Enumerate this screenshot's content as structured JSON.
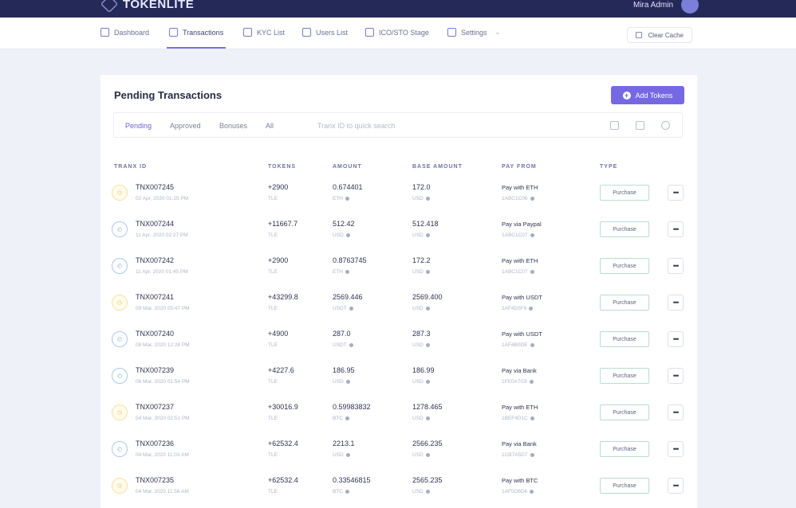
{
  "brand": {
    "name": "TOKENLITE"
  },
  "user": {
    "name": "Mira Admin"
  },
  "nav": {
    "items": [
      {
        "label": "Dashboard"
      },
      {
        "label": "Transactions"
      },
      {
        "label": "KYC List"
      },
      {
        "label": "Users List"
      },
      {
        "label": "ICO/STO Stage"
      },
      {
        "label": "Settings"
      }
    ],
    "clear_cache": "Clear Cache"
  },
  "page": {
    "title": "Pending Transactions",
    "add_button": "Add Tokens"
  },
  "filters": {
    "tabs": [
      "Pending",
      "Approved",
      "Bonuses",
      "All"
    ],
    "search_placeholder": "Tranx ID to quick search"
  },
  "table": {
    "headers": [
      "TRANX ID",
      "TOKENS",
      "AMOUNT",
      "BASE AMOUNT",
      "PAY FROM",
      "TYPE"
    ],
    "rows": [
      {
        "status": "warn",
        "id": "TNX007245",
        "date": "02 Apr, 2020 01:25 PM",
        "tokens": "+2900",
        "token_sym": "TLE",
        "amount": "0.674401",
        "amount_cur": "ETH",
        "base": "172.0",
        "base_cur": "USD",
        "pay": "Pay with ETH",
        "pay_sub": "1ABC1C06",
        "type": "Purchase"
      },
      {
        "status": "info",
        "id": "TNX007244",
        "date": "11 Apr, 2020 02:27 PM",
        "tokens": "+11667.7",
        "token_sym": "TLE",
        "amount": "512.42",
        "amount_cur": "USD",
        "base": "512.418",
        "base_cur": "USD",
        "pay": "Pay via Paypal",
        "pay_sub": "1ABC1C07",
        "type": "Purchase"
      },
      {
        "status": "info",
        "id": "TNX007242",
        "date": "11 Apr, 2020 01:45 PM",
        "tokens": "+2900",
        "token_sym": "TLE",
        "amount": "0.8763745",
        "amount_cur": "ETH",
        "base": "172.2",
        "base_cur": "USD",
        "pay": "Pay with ETH",
        "pay_sub": "1ABC1C07",
        "type": "Purchase"
      },
      {
        "status": "warn",
        "id": "TNX007241",
        "date": "09 Mar, 2020 05:47 PM",
        "tokens": "+43299.8",
        "token_sym": "TLE",
        "amount": "2569.446",
        "amount_cur": "USDT",
        "base": "2569.400",
        "base_cur": "USD",
        "pay": "Pay with USDT",
        "pay_sub": "1AF4D5F6",
        "type": "Purchase"
      },
      {
        "status": "info",
        "id": "TNX007240",
        "date": "08 Mar, 2020 12:28 PM",
        "tokens": "+4900",
        "token_sym": "TLE",
        "amount": "287.0",
        "amount_cur": "USDT",
        "base": "287.3",
        "base_cur": "USD",
        "pay": "Pay with USDT",
        "pay_sub": "1AF4B0DE",
        "type": "Purchase"
      },
      {
        "status": "info",
        "id": "TNX007239",
        "date": "06 Mar, 2020 01:54 PM",
        "tokens": "+4227.6",
        "token_sym": "TLE",
        "amount": "186.95",
        "amount_cur": "USD",
        "base": "186.99",
        "base_cur": "USD",
        "pay": "Pay via Bank",
        "pay_sub": "1FE0A7C8",
        "type": "Purchase"
      },
      {
        "status": "warn",
        "id": "TNX007237",
        "date": "04 Mar, 2020 02:51 PM",
        "tokens": "+30016.9",
        "token_sym": "TLE",
        "amount": "0.59983832",
        "amount_cur": "BTC",
        "base": "1278.465",
        "base_cur": "USD",
        "pay": "Pay with ETH",
        "pay_sub": "1BEF4D1C",
        "type": "Purchase"
      },
      {
        "status": "info",
        "id": "TNX007236",
        "date": "04 Mar, 2020 11:03 AM",
        "tokens": "+62532.4",
        "token_sym": "TLE",
        "amount": "2213.1",
        "amount_cur": "USD",
        "base": "2566.235",
        "base_cur": "USD",
        "pay": "Pay via Bank",
        "pay_sub": "1CB7A5D7",
        "type": "Purchase"
      },
      {
        "status": "warn",
        "id": "TNX007235",
        "date": "04 Mar, 2020 11:56 AM",
        "tokens": "+62532.4",
        "token_sym": "TLE",
        "amount": "0.33546815",
        "amount_cur": "BTC",
        "base": "2565.235",
        "base_cur": "USD",
        "pay": "Pay with BTC",
        "pay_sub": "1AF5D6D6",
        "type": "Purchase"
      }
    ]
  }
}
